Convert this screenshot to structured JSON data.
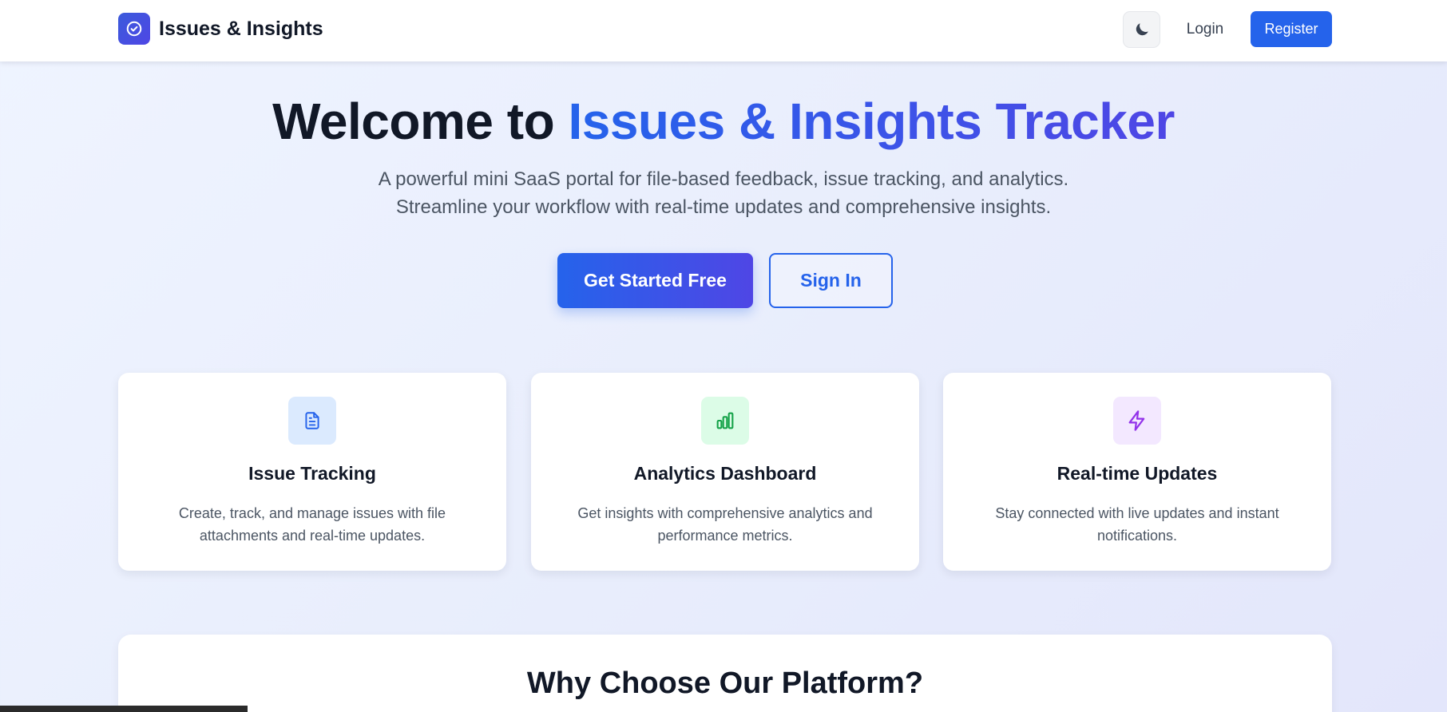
{
  "header": {
    "brand_name": "Issues & Insights",
    "login_label": "Login",
    "register_label": "Register"
  },
  "hero": {
    "title_prefix": "Welcome to ",
    "title_accent": "Issues & Insights Tracker",
    "subtitle_line1": "A powerful mini SaaS portal for file-based feedback, issue tracking, and analytics.",
    "subtitle_line2": "Streamline your workflow with real-time updates and comprehensive insights.",
    "primary_cta": "Get Started Free",
    "secondary_cta": "Sign In"
  },
  "features": [
    {
      "icon": "document-icon",
      "title": "Issue Tracking",
      "description": "Create, track, and manage issues with file attachments and real-time updates.",
      "icon_color": "#2563eb",
      "icon_bg": "#dbeafe"
    },
    {
      "icon": "bar-chart-icon",
      "title": "Analytics Dashboard",
      "description": "Get insights with comprehensive analytics and performance metrics.",
      "icon_color": "#16a34a",
      "icon_bg": "#dcfce7"
    },
    {
      "icon": "lightning-icon",
      "title": "Real-time Updates",
      "description": "Stay connected with live updates and instant notifications.",
      "icon_color": "#9333ea",
      "icon_bg": "#f3e8ff"
    }
  ],
  "why_section": {
    "title": "Why Choose Our Platform?"
  },
  "colors": {
    "primary": "#2563eb",
    "accent_end": "#4f46e5",
    "text_dark": "#111827",
    "text_muted": "#4b5563"
  }
}
